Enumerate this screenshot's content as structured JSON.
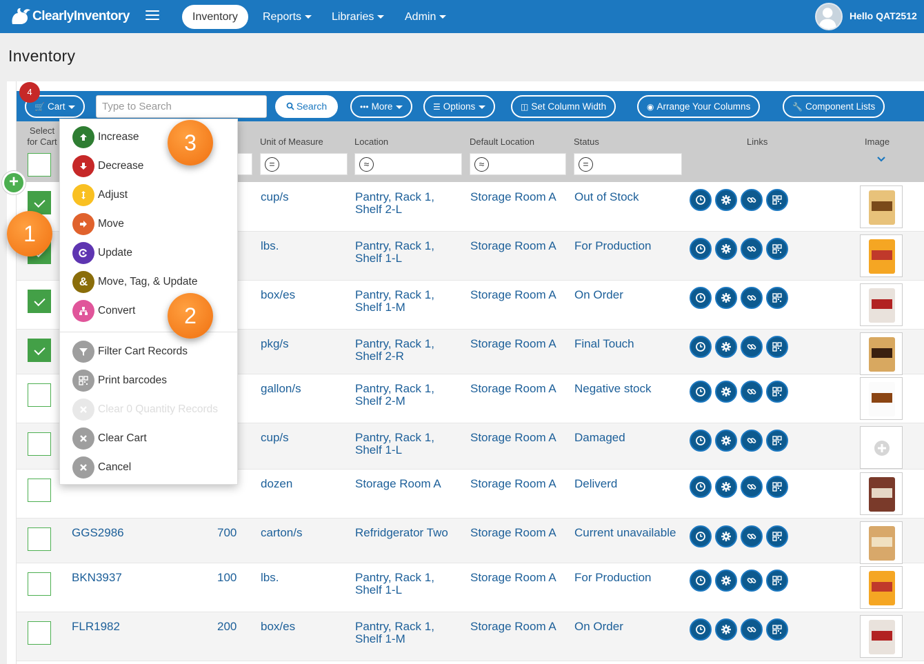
{
  "app": {
    "logo_text": "ClearlyInventory"
  },
  "nav": {
    "inventory": "Inventory",
    "reports": "Reports",
    "libraries": "Libraries",
    "admin": "Admin",
    "user_greeting": "Hello QAT2512"
  },
  "page": {
    "title": "Inventory"
  },
  "toolbar": {
    "cart_label": "Cart",
    "cart_count": "4",
    "search_placeholder": "Type to Search",
    "search_label": "Search",
    "more_label": "More",
    "options_label": "Options",
    "set_column_width_label": "Set Column Width",
    "arrange_columns_label": "Arrange Your Columns",
    "component_lists_label": "Component Lists"
  },
  "columns": {
    "select_for_cart": "Select for Cart",
    "unit_of_measure": "Unit of Measure",
    "location": "Location",
    "default_location": "Default Location",
    "status": "Status",
    "links": "Links",
    "image": "Image"
  },
  "filters": {
    "unit_of_measure": "=",
    "location": "≈",
    "default_location": "≈",
    "status": "="
  },
  "rows": [
    {
      "code": "",
      "qty": "",
      "unit": "cup/s",
      "location": [
        "Pantry, Rack 1,",
        "Shelf 2-L"
      ],
      "default_location": "Storage Room A",
      "status": "Out of Stock",
      "checked": true
    },
    {
      "code": "",
      "qty": "",
      "unit": "lbs.",
      "location": [
        "Pantry, Rack 1,",
        "Shelf 1-L"
      ],
      "default_location": "Storage Room A",
      "status": "For Production",
      "checked": true
    },
    {
      "code": "",
      "qty": "",
      "unit": "box/es",
      "location": [
        "Pantry, Rack 1,",
        "Shelf 1-M"
      ],
      "default_location": "Storage Room A",
      "status": "On Order",
      "checked": true
    },
    {
      "code": "",
      "qty": "",
      "unit": "pkg/s",
      "location": [
        "Pantry, Rack 1,",
        "Shelf 2-R"
      ],
      "default_location": "Storage Room A",
      "status": "Final Touch",
      "checked": true
    },
    {
      "code": "",
      "qty": "",
      "unit": "gallon/s",
      "location": [
        "Pantry, Rack 1,",
        "Shelf 2-M"
      ],
      "default_location": "Storage Room A",
      "status": "Negative stock",
      "checked": false
    },
    {
      "code": "",
      "qty": "",
      "unit": "cup/s",
      "location": [
        "Pantry, Rack 1,",
        "Shelf 1-L"
      ],
      "default_location": "Storage Room A",
      "status": "Damaged",
      "checked": false
    },
    {
      "code": "",
      "qty": "",
      "unit": "dozen",
      "location": [
        "Storage Room A",
        ""
      ],
      "default_location": "Storage Room A",
      "status": "Deliverd",
      "checked": false
    },
    {
      "code": "GGS2986",
      "qty": "700",
      "unit": "carton/s",
      "location": [
        "Refridgerator Two",
        ""
      ],
      "default_location": "Storage Room A",
      "status": "Current unavailable",
      "checked": false
    },
    {
      "code": "BKN3937",
      "qty": "100",
      "unit": "lbs.",
      "location": [
        "Pantry, Rack 1,",
        "Shelf 1-L"
      ],
      "default_location": "Storage Room A",
      "status": "For Production",
      "checked": false
    },
    {
      "code": "FLR1982",
      "qty": "200",
      "unit": "box/es",
      "location": [
        "Pantry, Rack 1,",
        "Shelf 1-M"
      ],
      "default_location": "Storage Room A",
      "status": "On Order",
      "checked": false
    }
  ],
  "menu": {
    "increase": "Increase",
    "decrease": "Decrease",
    "adjust": "Adjust",
    "move": "Move",
    "update": "Update",
    "move_tag_update": "Move, Tag, & Update",
    "convert": "Convert",
    "filter_cart": "Filter Cart Records",
    "print_barcodes": "Print barcodes",
    "clear_zero": "Clear 0 Quantity Records",
    "clear_cart": "Clear Cart",
    "cancel": "Cancel"
  },
  "callouts": {
    "c1": "1",
    "c2": "2",
    "c3": "3"
  },
  "colors": {
    "brand": "#1c78c0",
    "increase": "#2e7d32",
    "decrease": "#c62828",
    "adjust": "#f9c022",
    "move": "#e0622d",
    "update": "#5e35b1",
    "move_tag_update": "#8a6d0a",
    "convert": "#e0559a",
    "neutral": "#9e9e9e",
    "callout": "#f5841f"
  }
}
